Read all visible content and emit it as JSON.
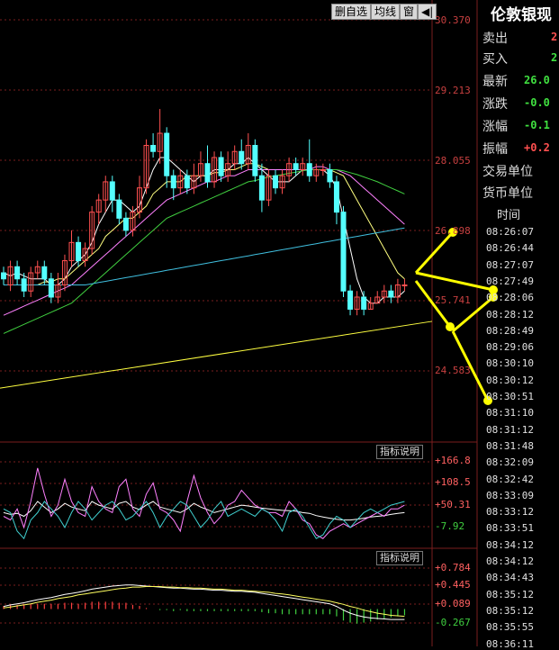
{
  "toolbar": {
    "buttons": [
      "删自选",
      "均线",
      "窗"
    ],
    "back_icon": "back-arrow-icon"
  },
  "price_axis": [
    "30.370",
    "29.213",
    "28.055",
    "26.898",
    "25.741",
    "24.583"
  ],
  "indicator1": {
    "button": "指标说明",
    "labels": [
      "+166.8",
      "+108.5",
      "+50.31",
      "-7.92"
    ]
  },
  "indicator2": {
    "button": "指标说明",
    "labels": [
      "+0.784",
      "+0.445",
      "+0.089",
      "-0.267"
    ]
  },
  "right_panel": {
    "title": "伦敦银现",
    "rows": [
      {
        "label": "卖出",
        "value": "2"
      },
      {
        "label": "买入",
        "value": "2"
      },
      {
        "label": "最新",
        "value": "26.0"
      },
      {
        "label": "涨跌",
        "value": "-0.0"
      },
      {
        "label": "涨幅",
        "value": "-0.1"
      },
      {
        "label": "振幅",
        "value": "+0.2"
      },
      {
        "label": "交易单位",
        "value": ""
      },
      {
        "label": "货币单位",
        "value": ""
      }
    ],
    "time_header": "时间",
    "times": [
      "08:26:07",
      "08:26:44",
      "08:27:07",
      "08:27:49",
      "08:28:06",
      "08:28:12",
      "08:28:49",
      "08:29:06",
      "08:30:10",
      "08:30:12",
      "08:30:51",
      "08:31:10",
      "08:31:12",
      "08:31:48",
      "08:32:09",
      "08:32:42",
      "08:33:09",
      "08:33:12",
      "08:33:51",
      "08:34:12",
      "08:34:12",
      "08:34:43",
      "08:35:12",
      "08:35:12",
      "08:35:55",
      "08:36:11"
    ]
  },
  "colors": {
    "up": "#ff5050",
    "down": "#54ffff",
    "ma1": "#ffffff",
    "ma2": "#ffff80",
    "ma3": "#ff80ff",
    "ma4": "#40d040",
    "ma5": "#40c0e0",
    "long_line": "#ffff40",
    "arrows": "#ffff00",
    "grid": "#7a1e1e"
  },
  "chart_data": {
    "type": "candlestick",
    "price_ylim": [
      24.0,
      30.9
    ],
    "candles": [
      {
        "o": 26.2,
        "c": 26.1,
        "h": 26.3,
        "l": 26.0
      },
      {
        "o": 26.0,
        "c": 26.3,
        "h": 26.4,
        "l": 25.9
      },
      {
        "o": 26.3,
        "c": 26.1,
        "h": 26.4,
        "l": 26.0
      },
      {
        "o": 26.1,
        "c": 25.9,
        "h": 26.2,
        "l": 25.8
      },
      {
        "o": 25.9,
        "c": 26.2,
        "h": 26.3,
        "l": 25.8
      },
      {
        "o": 26.2,
        "c": 26.3,
        "h": 26.4,
        "l": 26.1
      },
      {
        "o": 26.3,
        "c": 26.1,
        "h": 26.4,
        "l": 26.0
      },
      {
        "o": 26.1,
        "c": 25.8,
        "h": 26.2,
        "l": 25.7
      },
      {
        "o": 25.8,
        "c": 26.0,
        "h": 26.2,
        "l": 25.7
      },
      {
        "o": 26.0,
        "c": 26.4,
        "h": 26.5,
        "l": 25.9
      },
      {
        "o": 26.4,
        "c": 26.7,
        "h": 26.9,
        "l": 26.3
      },
      {
        "o": 26.7,
        "c": 26.4,
        "h": 26.8,
        "l": 26.3
      },
      {
        "o": 26.4,
        "c": 26.6,
        "h": 26.7,
        "l": 26.3
      },
      {
        "o": 26.6,
        "c": 27.2,
        "h": 27.3,
        "l": 26.5
      },
      {
        "o": 27.2,
        "c": 27.4,
        "h": 27.5,
        "l": 27.0
      },
      {
        "o": 27.4,
        "c": 27.7,
        "h": 27.8,
        "l": 27.2
      },
      {
        "o": 27.7,
        "c": 27.4,
        "h": 27.8,
        "l": 27.2
      },
      {
        "o": 27.4,
        "c": 27.1,
        "h": 27.5,
        "l": 27.0
      },
      {
        "o": 27.1,
        "c": 26.9,
        "h": 27.2,
        "l": 26.8
      },
      {
        "o": 26.9,
        "c": 27.2,
        "h": 27.3,
        "l": 26.8
      },
      {
        "o": 27.2,
        "c": 27.6,
        "h": 27.8,
        "l": 27.1
      },
      {
        "o": 27.6,
        "c": 28.3,
        "h": 28.4,
        "l": 27.5
      },
      {
        "o": 28.3,
        "c": 28.2,
        "h": 28.5,
        "l": 28.1
      },
      {
        "o": 28.2,
        "c": 28.5,
        "h": 28.9,
        "l": 28.0
      },
      {
        "o": 28.5,
        "c": 27.8,
        "h": 28.6,
        "l": 27.6
      },
      {
        "o": 27.8,
        "c": 27.6,
        "h": 27.9,
        "l": 27.4
      },
      {
        "o": 27.6,
        "c": 27.8,
        "h": 27.9,
        "l": 27.5
      },
      {
        "o": 27.8,
        "c": 27.6,
        "h": 27.9,
        "l": 27.5
      },
      {
        "o": 27.6,
        "c": 27.8,
        "h": 28.0,
        "l": 27.5
      },
      {
        "o": 27.8,
        "c": 28.0,
        "h": 28.2,
        "l": 27.7
      },
      {
        "o": 28.0,
        "c": 27.7,
        "h": 28.3,
        "l": 27.6
      },
      {
        "o": 27.7,
        "c": 28.1,
        "h": 28.2,
        "l": 27.6
      },
      {
        "o": 28.1,
        "c": 27.8,
        "h": 28.2,
        "l": 27.7
      },
      {
        "o": 27.8,
        "c": 28.0,
        "h": 28.2,
        "l": 27.7
      },
      {
        "o": 28.0,
        "c": 28.2,
        "h": 28.3,
        "l": 27.9
      },
      {
        "o": 28.2,
        "c": 28.0,
        "h": 28.4,
        "l": 27.9
      },
      {
        "o": 28.0,
        "c": 28.3,
        "h": 28.5,
        "l": 27.9
      },
      {
        "o": 28.3,
        "c": 27.8,
        "h": 28.4,
        "l": 27.7
      },
      {
        "o": 27.8,
        "c": 27.4,
        "h": 28.0,
        "l": 27.2
      },
      {
        "o": 27.4,
        "c": 27.8,
        "h": 27.9,
        "l": 27.3
      },
      {
        "o": 27.8,
        "c": 27.6,
        "h": 27.9,
        "l": 27.5
      },
      {
        "o": 27.6,
        "c": 27.8,
        "h": 27.9,
        "l": 27.5
      },
      {
        "o": 27.8,
        "c": 28.0,
        "h": 28.1,
        "l": 27.7
      },
      {
        "o": 28.0,
        "c": 27.9,
        "h": 28.1,
        "l": 27.8
      },
      {
        "o": 27.9,
        "c": 28.0,
        "h": 28.1,
        "l": 27.8
      },
      {
        "o": 28.0,
        "c": 27.8,
        "h": 28.4,
        "l": 27.7
      },
      {
        "o": 27.8,
        "c": 27.9,
        "h": 28.0,
        "l": 27.7
      },
      {
        "o": 27.9,
        "c": 27.9,
        "h": 28.0,
        "l": 27.8
      },
      {
        "o": 27.9,
        "c": 27.7,
        "h": 28.0,
        "l": 27.6
      },
      {
        "o": 27.7,
        "c": 27.2,
        "h": 27.8,
        "l": 27.0
      },
      {
        "o": 27.2,
        "c": 25.9,
        "h": 27.3,
        "l": 25.8
      },
      {
        "o": 25.9,
        "c": 25.6,
        "h": 26.0,
        "l": 25.5
      },
      {
        "o": 25.6,
        "c": 25.8,
        "h": 25.9,
        "l": 25.5
      },
      {
        "o": 25.8,
        "c": 25.6,
        "h": 25.9,
        "l": 25.5
      },
      {
        "o": 25.6,
        "c": 25.7,
        "h": 25.8,
        "l": 25.6
      },
      {
        "o": 25.7,
        "c": 25.8,
        "h": 25.9,
        "l": 25.7
      },
      {
        "o": 25.8,
        "c": 25.9,
        "h": 26.0,
        "l": 25.7
      },
      {
        "o": 25.9,
        "c": 25.8,
        "h": 26.0,
        "l": 25.7
      },
      {
        "o": 25.8,
        "c": 26.0,
        "h": 26.1,
        "l": 25.7
      },
      {
        "o": 26.0,
        "c": 26.0,
        "h": 26.1,
        "l": 25.9
      }
    ],
    "ma_lines": [
      {
        "values": [
          26.2,
          26.15,
          26.2,
          26.15,
          26.1,
          26.1,
          26.1,
          26.0,
          26.0,
          26.1,
          26.3,
          26.4,
          26.5,
          26.7,
          27.0,
          27.2,
          27.4,
          27.4,
          27.3,
          27.2,
          27.3,
          27.6,
          27.9,
          28.1,
          28.1,
          28.0,
          27.9,
          27.8,
          27.7,
          27.8,
          27.8,
          27.9,
          27.9,
          27.9,
          28.0,
          28.0,
          28.1,
          28.0,
          27.9,
          27.8,
          27.7,
          27.7,
          27.7,
          27.8,
          27.9,
          27.9,
          27.9,
          27.9,
          27.8,
          27.6,
          27.1,
          26.6,
          26.1,
          25.8,
          25.7,
          25.7,
          25.8,
          25.8,
          25.8,
          25.9
        ]
      },
      {
        "values": [
          26.0,
          26.0,
          26.0,
          26.0,
          26.0,
          26.0,
          26.05,
          26.05,
          26.1,
          26.1,
          26.2,
          26.3,
          26.4,
          26.5,
          26.6,
          26.8,
          26.9,
          27.0,
          27.1,
          27.1,
          27.2,
          27.3,
          27.5,
          27.6,
          27.7,
          27.7,
          27.7,
          27.8,
          27.8,
          27.8,
          27.8,
          27.85,
          27.85,
          27.9,
          27.9,
          27.95,
          28.0,
          28.0,
          27.95,
          27.9,
          27.9,
          27.9,
          27.9,
          27.9,
          27.9,
          27.9,
          27.9,
          27.9,
          27.9,
          27.85,
          27.8,
          27.6,
          27.4,
          27.2,
          27.0,
          26.8,
          26.6,
          26.4,
          26.2,
          26.1
        ]
      },
      {
        "values": [
          25.5,
          25.55,
          25.6,
          25.65,
          25.7,
          25.75,
          25.8,
          25.85,
          25.9,
          25.95,
          26.0,
          26.1,
          26.2,
          26.3,
          26.4,
          26.5,
          26.6,
          26.7,
          26.8,
          26.9,
          27.0,
          27.1,
          27.2,
          27.3,
          27.4,
          27.45,
          27.5,
          27.55,
          27.6,
          27.65,
          27.7,
          27.7,
          27.75,
          27.8,
          27.8,
          27.85,
          27.9,
          27.9,
          27.9,
          27.9,
          27.9,
          27.9,
          27.9,
          27.9,
          27.9,
          27.9,
          27.95,
          27.95,
          27.9,
          27.9,
          27.85,
          27.8,
          27.7,
          27.6,
          27.5,
          27.4,
          27.3,
          27.2,
          27.1,
          27.0
        ]
      },
      {
        "values": [
          25.2,
          25.25,
          25.3,
          25.35,
          25.4,
          25.45,
          25.5,
          25.55,
          25.6,
          25.65,
          25.7,
          25.8,
          25.9,
          26.0,
          26.1,
          26.2,
          26.3,
          26.4,
          26.5,
          26.6,
          26.7,
          26.8,
          26.9,
          27.0,
          27.1,
          27.15,
          27.2,
          27.25,
          27.3,
          27.35,
          27.4,
          27.45,
          27.5,
          27.55,
          27.6,
          27.65,
          27.7,
          27.72,
          27.75,
          27.78,
          27.8,
          27.82,
          27.84,
          27.86,
          27.88,
          27.9,
          27.9,
          27.9,
          27.9,
          27.9,
          27.88,
          27.85,
          27.82,
          27.78,
          27.74,
          27.7,
          27.65,
          27.6,
          27.55,
          27.5
        ]
      },
      {
        "values": [
          26.0,
          26.0,
          26.0,
          26.0,
          26.0,
          26.0,
          26.0,
          26.0,
          26.0,
          26.0,
          26.0,
          26.0,
          26.0,
          26.02,
          26.04,
          26.06,
          26.08,
          26.1,
          26.12,
          26.14,
          26.16,
          26.18,
          26.2,
          26.22,
          26.24,
          26.26,
          26.28,
          26.3,
          26.32,
          26.34,
          26.36,
          26.38,
          26.4,
          26.42,
          26.44,
          26.46,
          26.48,
          26.5,
          26.52,
          26.54,
          26.56,
          26.58,
          26.6,
          26.62,
          26.64,
          26.66,
          26.68,
          26.7,
          26.72,
          26.74,
          26.76,
          26.78,
          26.8,
          26.82,
          26.84,
          26.86,
          26.88,
          26.9,
          26.92,
          26.94
        ]
      }
    ],
    "long_line": {
      "start": 24.3,
      "end": 25.4
    },
    "indicator1_ylim": [
      -60,
      190
    ],
    "indicator1_series": [
      {
        "values": [
          30,
          25,
          28,
          20,
          35,
          60,
          45,
          30,
          40,
          55,
          45,
          40,
          35,
          60,
          50,
          45,
          40,
          55,
          60,
          45,
          38,
          50,
          60,
          45,
          40,
          35,
          30,
          40,
          55,
          45,
          38,
          30,
          35,
          40,
          45,
          50,
          48,
          45,
          42,
          40,
          38,
          36,
          35,
          34,
          30,
          28,
          22,
          18,
          15,
          12,
          10,
          10,
          12,
          15,
          18,
          20,
          22,
          25,
          28,
          30
        ]
      },
      {
        "values": [
          20,
          10,
          40,
          -10,
          60,
          150,
          80,
          20,
          50,
          120,
          60,
          30,
          20,
          100,
          60,
          40,
          30,
          100,
          120,
          40,
          20,
          80,
          110,
          40,
          30,
          10,
          -20,
          60,
          130,
          70,
          30,
          0,
          20,
          50,
          60,
          90,
          70,
          50,
          40,
          30,
          30,
          20,
          60,
          40,
          10,
          0,
          -30,
          -40,
          -20,
          -10,
          0,
          -10,
          0,
          10,
          20,
          30,
          20,
          40,
          40,
          50
        ]
      },
      {
        "values": [
          40,
          30,
          -20,
          -40,
          10,
          30,
          60,
          40,
          20,
          -10,
          30,
          60,
          40,
          10,
          30,
          50,
          60,
          40,
          10,
          20,
          40,
          60,
          30,
          -10,
          20,
          40,
          60,
          50,
          20,
          -10,
          10,
          40,
          60,
          20,
          30,
          40,
          30,
          20,
          40,
          30,
          10,
          -20,
          30,
          40,
          20,
          -10,
          -40,
          -30,
          0,
          20,
          10,
          -10,
          10,
          30,
          40,
          30,
          40,
          50,
          55,
          60
        ]
      }
    ],
    "indicator2_ylim": [
      -0.45,
      0.95
    ],
    "indicator2_series": [
      {
        "values": [
          0.05,
          0.08,
          0.1,
          0.12,
          0.15,
          0.18,
          0.2,
          0.22,
          0.25,
          0.28,
          0.3,
          0.32,
          0.35,
          0.38,
          0.4,
          0.42,
          0.44,
          0.45,
          0.46,
          0.46,
          0.45,
          0.44,
          0.43,
          0.42,
          0.41,
          0.4,
          0.4,
          0.39,
          0.38,
          0.38,
          0.37,
          0.36,
          0.36,
          0.35,
          0.34,
          0.34,
          0.33,
          0.32,
          0.3,
          0.28,
          0.26,
          0.24,
          0.22,
          0.2,
          0.18,
          0.16,
          0.14,
          0.12,
          0.1,
          0.05,
          -0.02,
          -0.08,
          -0.12,
          -0.15,
          -0.17,
          -0.18,
          -0.19,
          -0.2,
          -0.2,
          -0.2
        ]
      },
      {
        "values": [
          0.02,
          0.04,
          0.06,
          0.08,
          0.1,
          0.13,
          0.15,
          0.17,
          0.2,
          0.22,
          0.24,
          0.27,
          0.29,
          0.31,
          0.33,
          0.35,
          0.37,
          0.39,
          0.4,
          0.42,
          0.42,
          0.43,
          0.43,
          0.43,
          0.42,
          0.42,
          0.41,
          0.41,
          0.4,
          0.4,
          0.39,
          0.38,
          0.38,
          0.37,
          0.36,
          0.36,
          0.35,
          0.34,
          0.33,
          0.32,
          0.3,
          0.29,
          0.27,
          0.25,
          0.23,
          0.21,
          0.19,
          0.17,
          0.15,
          0.12,
          0.09,
          0.05,
          0.02,
          -0.02,
          -0.05,
          -0.08,
          -0.1,
          -0.12,
          -0.13,
          -0.14
        ]
      }
    ],
    "indicator2_bars": [
      0.06,
      0.08,
      0.08,
      0.08,
      0.1,
      0.1,
      0.1,
      0.1,
      0.1,
      0.12,
      0.12,
      0.1,
      0.12,
      0.14,
      0.14,
      0.14,
      0.14,
      0.12,
      0.12,
      0.08,
      0.06,
      0.02,
      0.0,
      -0.02,
      -0.02,
      -0.04,
      -0.02,
      -0.04,
      -0.04,
      -0.04,
      -0.04,
      -0.04,
      -0.04,
      -0.04,
      -0.04,
      -0.04,
      -0.04,
      -0.04,
      -0.06,
      -0.08,
      -0.08,
      -0.1,
      -0.1,
      -0.1,
      -0.1,
      -0.1,
      -0.1,
      -0.1,
      -0.1,
      -0.14,
      -0.22,
      -0.26,
      -0.28,
      -0.26,
      -0.24,
      -0.2,
      -0.18,
      -0.16,
      -0.14,
      -0.12
    ]
  }
}
